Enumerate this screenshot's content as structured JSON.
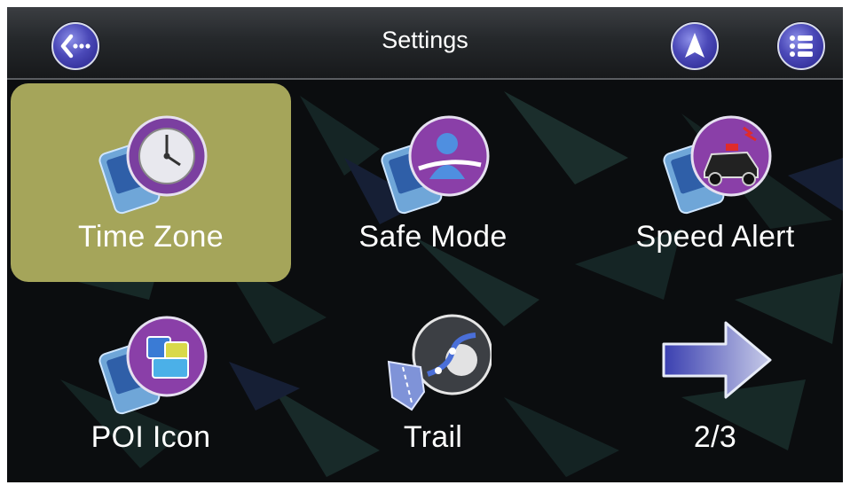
{
  "header": {
    "title": "Settings",
    "back_icon": "back-ellipsis-icon",
    "navigate_icon": "navigation-arrow-icon",
    "menu_icon": "list-menu-icon"
  },
  "tiles": [
    {
      "label": "Time Zone",
      "icon": "time-zone-icon",
      "selected": true
    },
    {
      "label": "Safe Mode",
      "icon": "safe-mode-icon",
      "selected": false
    },
    {
      "label": "Speed Alert",
      "icon": "speed-alert-icon",
      "selected": false
    },
    {
      "label": "POI Icon",
      "icon": "poi-icon",
      "selected": false
    },
    {
      "label": "Trail",
      "icon": "trail-icon",
      "selected": false
    },
    {
      "label": "2/3",
      "icon": "next-page-arrow-icon",
      "selected": false
    }
  ],
  "colors": {
    "selected_tile": "#a5a55a",
    "button_purple": "#4b49b8",
    "background": "#0b0d0f"
  }
}
